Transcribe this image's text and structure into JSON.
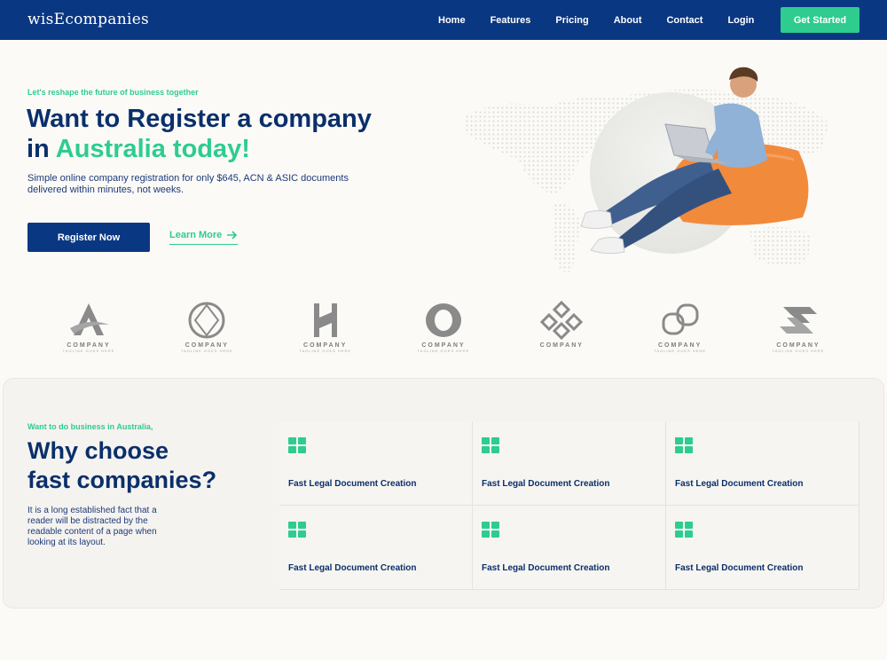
{
  "nav": {
    "logo": "wisEcompanies",
    "links": [
      "Home",
      "Features",
      "Pricing",
      "About",
      "Contact",
      "Login"
    ],
    "cta": "Get Started"
  },
  "hero": {
    "eyebrow": "Let's reshape the future of business together",
    "title_line1": "Want to Register a company",
    "title_line2_prefix": "in ",
    "title_line2_accent": "Australia today!",
    "description": "Simple online company registration for only $645, ACN & ASIC documents delivered within minutes, not weeks.",
    "primary_button": "Register Now",
    "secondary_link": "Learn More"
  },
  "logos": [
    {
      "name": "COMPANY",
      "tagline": "TAGLINE GOES HERE",
      "icon": "triangle-swoosh-icon"
    },
    {
      "name": "COMPANY",
      "tagline": "TAGLINE GOES HERE",
      "icon": "diamond-petal-icon"
    },
    {
      "name": "COMPANY",
      "tagline": "TAGLINE GOES HERE",
      "icon": "h-letter-icon"
    },
    {
      "name": "COMPANY",
      "tagline": "TAGLINE GOES HERE",
      "icon": "ring-hexagon-icon"
    },
    {
      "name": "COMPANY",
      "tagline": "",
      "icon": "diamond-grid-icon"
    },
    {
      "name": "COMPANY",
      "tagline": "TAGLINE GOES HERE",
      "icon": "linked-squares-icon"
    },
    {
      "name": "COMPANY",
      "tagline": "TAGLINE GOES HERE",
      "icon": "s-chevron-icon"
    }
  ],
  "why": {
    "eyebrow": "Want to do business in Australia,",
    "title_line1": "Why choose",
    "title_line2": "fast companies?",
    "description": "It is a long established fact that a reader will be distracted by the readable content of a page when looking at its layout.",
    "features": [
      {
        "label": "Fast Legal Document Creation",
        "icon": "grid-icon"
      },
      {
        "label": "Fast Legal Document Creation",
        "icon": "grid-icon"
      },
      {
        "label": "Fast Legal Document Creation",
        "icon": "grid-icon"
      },
      {
        "label": "Fast Legal Document Creation",
        "icon": "grid-icon"
      },
      {
        "label": "Fast Legal Document Creation",
        "icon": "grid-icon"
      },
      {
        "label": "Fast Legal Document Creation",
        "icon": "grid-icon"
      }
    ]
  },
  "colors": {
    "primary": "#0a3782",
    "accent": "#2ecc8f",
    "heading": "#0a2f6b",
    "background": "#fbfaf6"
  }
}
